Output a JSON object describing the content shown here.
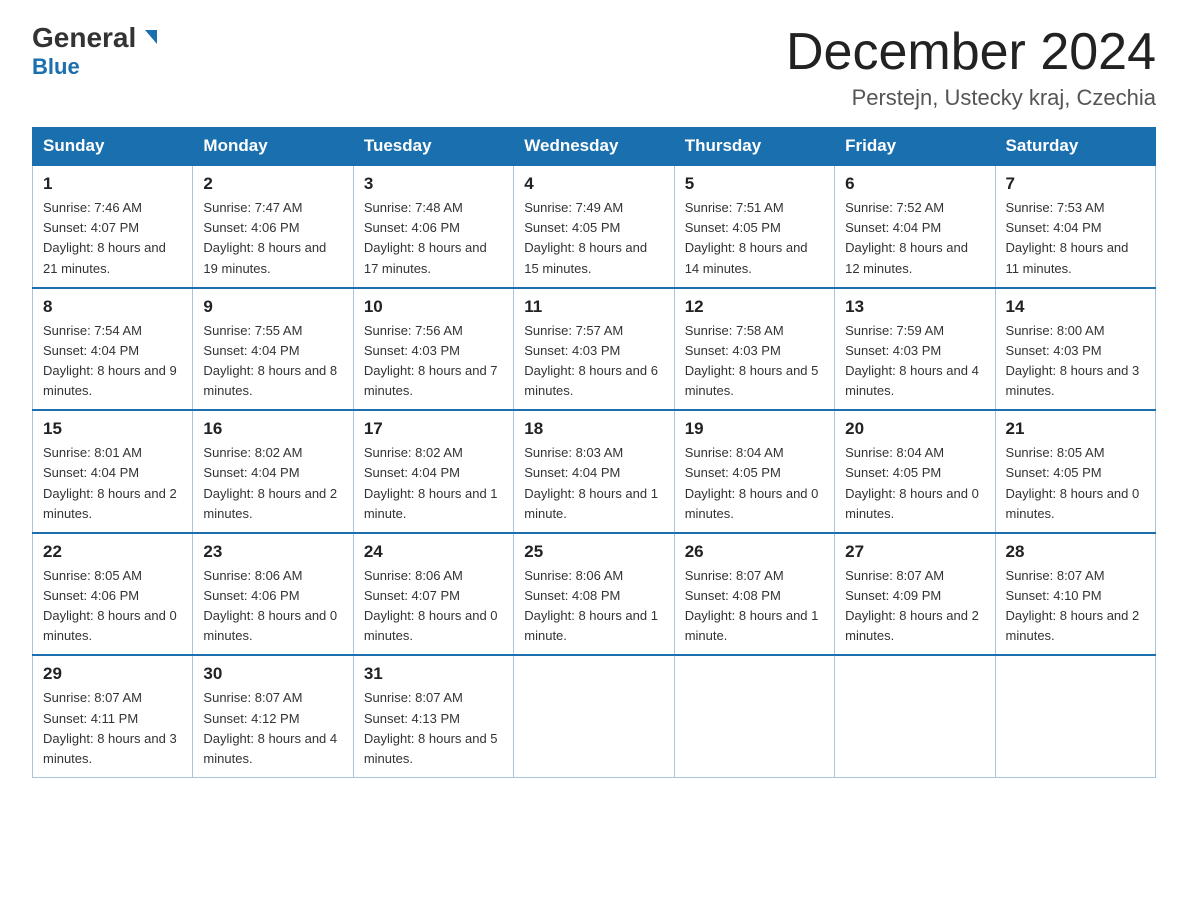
{
  "logo": {
    "general": "General",
    "blue": "Blue"
  },
  "header": {
    "title": "December 2024",
    "subtitle": "Perstejn, Ustecky kraj, Czechia"
  },
  "days_of_week": [
    "Sunday",
    "Monday",
    "Tuesday",
    "Wednesday",
    "Thursday",
    "Friday",
    "Saturday"
  ],
  "weeks": [
    [
      {
        "num": "1",
        "sunrise": "7:46 AM",
        "sunset": "4:07 PM",
        "daylight": "8 hours and 21 minutes."
      },
      {
        "num": "2",
        "sunrise": "7:47 AM",
        "sunset": "4:06 PM",
        "daylight": "8 hours and 19 minutes."
      },
      {
        "num": "3",
        "sunrise": "7:48 AM",
        "sunset": "4:06 PM",
        "daylight": "8 hours and 17 minutes."
      },
      {
        "num": "4",
        "sunrise": "7:49 AM",
        "sunset": "4:05 PM",
        "daylight": "8 hours and 15 minutes."
      },
      {
        "num": "5",
        "sunrise": "7:51 AM",
        "sunset": "4:05 PM",
        "daylight": "8 hours and 14 minutes."
      },
      {
        "num": "6",
        "sunrise": "7:52 AM",
        "sunset": "4:04 PM",
        "daylight": "8 hours and 12 minutes."
      },
      {
        "num": "7",
        "sunrise": "7:53 AM",
        "sunset": "4:04 PM",
        "daylight": "8 hours and 11 minutes."
      }
    ],
    [
      {
        "num": "8",
        "sunrise": "7:54 AM",
        "sunset": "4:04 PM",
        "daylight": "8 hours and 9 minutes."
      },
      {
        "num": "9",
        "sunrise": "7:55 AM",
        "sunset": "4:04 PM",
        "daylight": "8 hours and 8 minutes."
      },
      {
        "num": "10",
        "sunrise": "7:56 AM",
        "sunset": "4:03 PM",
        "daylight": "8 hours and 7 minutes."
      },
      {
        "num": "11",
        "sunrise": "7:57 AM",
        "sunset": "4:03 PM",
        "daylight": "8 hours and 6 minutes."
      },
      {
        "num": "12",
        "sunrise": "7:58 AM",
        "sunset": "4:03 PM",
        "daylight": "8 hours and 5 minutes."
      },
      {
        "num": "13",
        "sunrise": "7:59 AM",
        "sunset": "4:03 PM",
        "daylight": "8 hours and 4 minutes."
      },
      {
        "num": "14",
        "sunrise": "8:00 AM",
        "sunset": "4:03 PM",
        "daylight": "8 hours and 3 minutes."
      }
    ],
    [
      {
        "num": "15",
        "sunrise": "8:01 AM",
        "sunset": "4:04 PM",
        "daylight": "8 hours and 2 minutes."
      },
      {
        "num": "16",
        "sunrise": "8:02 AM",
        "sunset": "4:04 PM",
        "daylight": "8 hours and 2 minutes."
      },
      {
        "num": "17",
        "sunrise": "8:02 AM",
        "sunset": "4:04 PM",
        "daylight": "8 hours and 1 minute."
      },
      {
        "num": "18",
        "sunrise": "8:03 AM",
        "sunset": "4:04 PM",
        "daylight": "8 hours and 1 minute."
      },
      {
        "num": "19",
        "sunrise": "8:04 AM",
        "sunset": "4:05 PM",
        "daylight": "8 hours and 0 minutes."
      },
      {
        "num": "20",
        "sunrise": "8:04 AM",
        "sunset": "4:05 PM",
        "daylight": "8 hours and 0 minutes."
      },
      {
        "num": "21",
        "sunrise": "8:05 AM",
        "sunset": "4:05 PM",
        "daylight": "8 hours and 0 minutes."
      }
    ],
    [
      {
        "num": "22",
        "sunrise": "8:05 AM",
        "sunset": "4:06 PM",
        "daylight": "8 hours and 0 minutes."
      },
      {
        "num": "23",
        "sunrise": "8:06 AM",
        "sunset": "4:06 PM",
        "daylight": "8 hours and 0 minutes."
      },
      {
        "num": "24",
        "sunrise": "8:06 AM",
        "sunset": "4:07 PM",
        "daylight": "8 hours and 0 minutes."
      },
      {
        "num": "25",
        "sunrise": "8:06 AM",
        "sunset": "4:08 PM",
        "daylight": "8 hours and 1 minute."
      },
      {
        "num": "26",
        "sunrise": "8:07 AM",
        "sunset": "4:08 PM",
        "daylight": "8 hours and 1 minute."
      },
      {
        "num": "27",
        "sunrise": "8:07 AM",
        "sunset": "4:09 PM",
        "daylight": "8 hours and 2 minutes."
      },
      {
        "num": "28",
        "sunrise": "8:07 AM",
        "sunset": "4:10 PM",
        "daylight": "8 hours and 2 minutes."
      }
    ],
    [
      {
        "num": "29",
        "sunrise": "8:07 AM",
        "sunset": "4:11 PM",
        "daylight": "8 hours and 3 minutes."
      },
      {
        "num": "30",
        "sunrise": "8:07 AM",
        "sunset": "4:12 PM",
        "daylight": "8 hours and 4 minutes."
      },
      {
        "num": "31",
        "sunrise": "8:07 AM",
        "sunset": "4:13 PM",
        "daylight": "8 hours and 5 minutes."
      },
      null,
      null,
      null,
      null
    ]
  ]
}
